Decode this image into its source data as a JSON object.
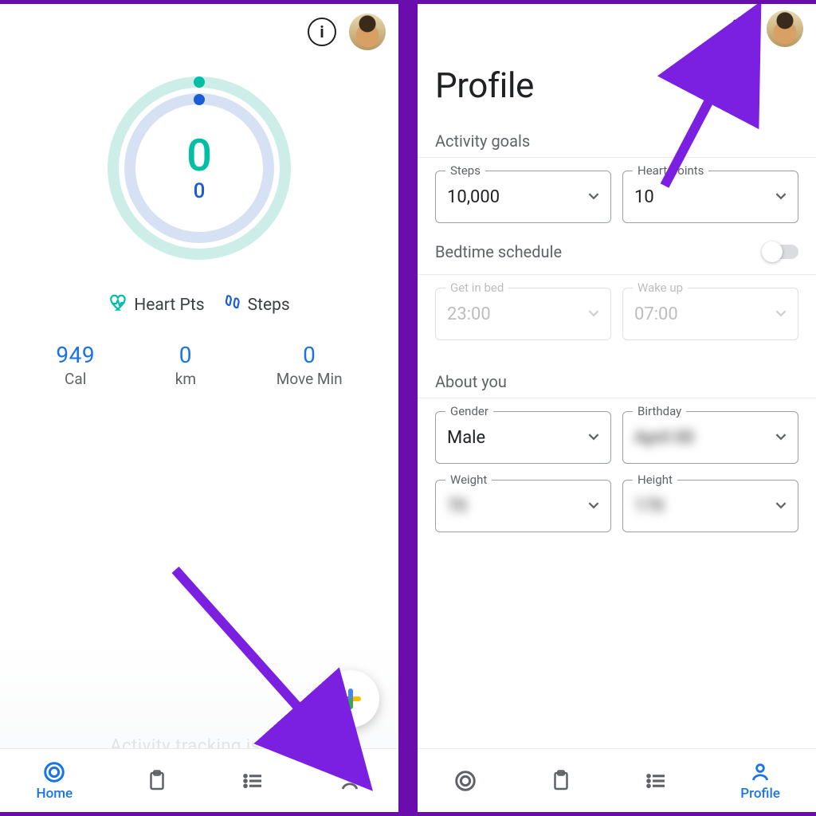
{
  "home": {
    "center_primary": "0",
    "center_secondary": "0",
    "legend": {
      "heart": "Heart Pts",
      "steps": "Steps"
    },
    "stats": {
      "cal": {
        "value": "949",
        "label": "Cal"
      },
      "km": {
        "value": "0",
        "label": "km"
      },
      "move": {
        "value": "0",
        "label": "Move Min"
      }
    },
    "faint": "Activity tracking is off",
    "nav": {
      "home": "Home"
    }
  },
  "profile": {
    "title": "Profile",
    "activity_goals": {
      "label": "Activity goals",
      "steps": {
        "legend": "Steps",
        "value": "10,000"
      },
      "heart": {
        "legend": "Heart Points",
        "value": "10"
      }
    },
    "bedtime": {
      "label": "Bedtime schedule",
      "get_in": {
        "legend": "Get in bed",
        "value": "23:00"
      },
      "wake": {
        "legend": "Wake up",
        "value": "07:00"
      }
    },
    "about_you": {
      "label": "About you",
      "gender": {
        "legend": "Gender",
        "value": "Male"
      },
      "birthday": {
        "legend": "Birthday",
        "value": "April 00"
      },
      "weight": {
        "legend": "Weight",
        "value": "70"
      },
      "height": {
        "legend": "Height",
        "value": "170"
      }
    },
    "nav": {
      "profile": "Profile"
    }
  },
  "colors": {
    "accent": "#1a73e8",
    "teal": "#00bfa5",
    "arrow": "#7b1fe0"
  }
}
